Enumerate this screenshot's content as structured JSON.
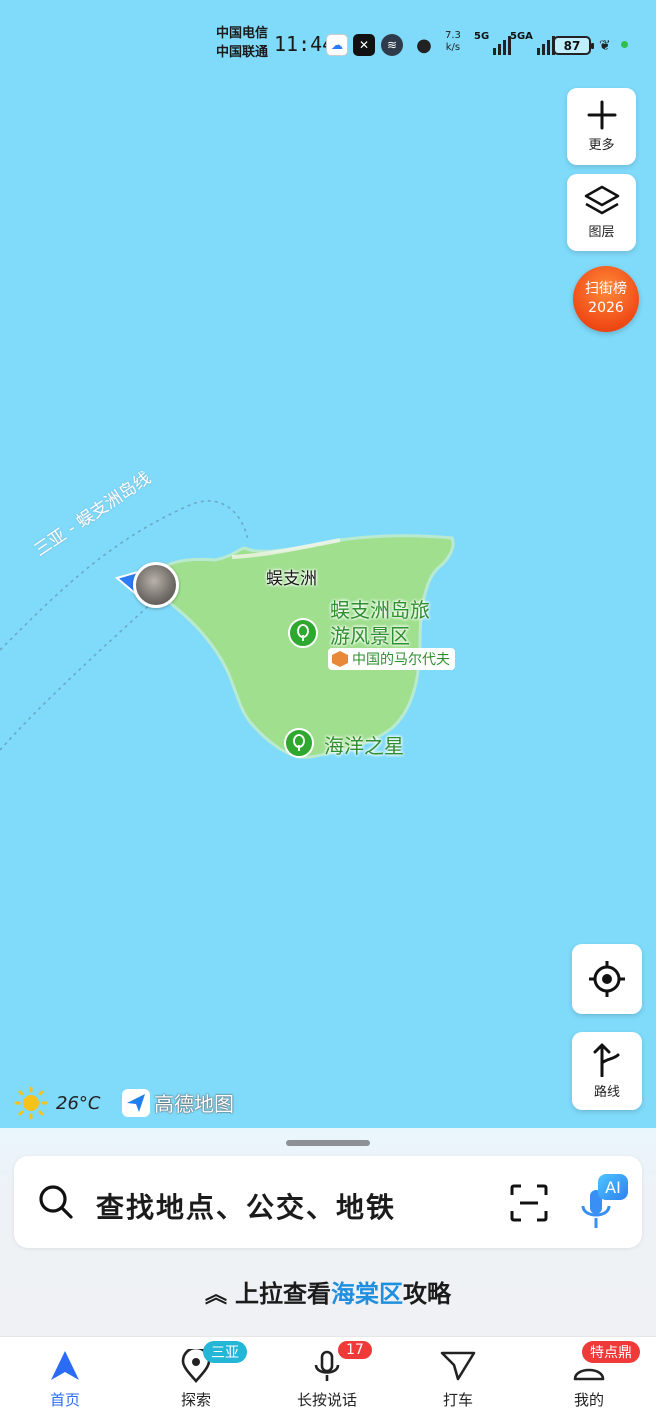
{
  "status_bar": {
    "carrier_1": "中国电信",
    "carrier_2": "中国联通",
    "time": "11:44",
    "net_speed_value": "7.3",
    "net_speed_unit": "k/s",
    "signal_1_label": "5G",
    "signal_2_label": "5GA",
    "battery": "87"
  },
  "map": {
    "ferry_route_label": "三亚 - 蜈支洲岛线",
    "island_label": "蜈支洲",
    "poi_scenic_line1": "蜈支洲岛旅",
    "poi_scenic_line2": "游风景区",
    "poi_scenic_tag": "中国的马尔代夫",
    "poi_star": "海洋之星",
    "colors": {
      "water": "#80dbfb",
      "land": "#9fdf8e",
      "poi_green": "#2ea82e"
    }
  },
  "controls": {
    "more_label": "更多",
    "layers_label": "图层",
    "rank_line1": "扫街榜",
    "rank_line2": "2026",
    "route_label": "路线"
  },
  "weather": {
    "temperature": "26°C"
  },
  "brand": {
    "name": "高德地图"
  },
  "search": {
    "placeholder": "查找地点、公交、地铁",
    "ai_label": "AI"
  },
  "pull_up": {
    "prefix": "上拉查看",
    "district": "海棠区",
    "suffix": "攻略"
  },
  "tabs": [
    {
      "label": "首页",
      "active": true
    },
    {
      "label": "探索",
      "badge": "三亚"
    },
    {
      "label": "长按说话",
      "badge": "17"
    },
    {
      "label": "打车"
    },
    {
      "label": "我的",
      "badge": "特点鼎"
    }
  ]
}
